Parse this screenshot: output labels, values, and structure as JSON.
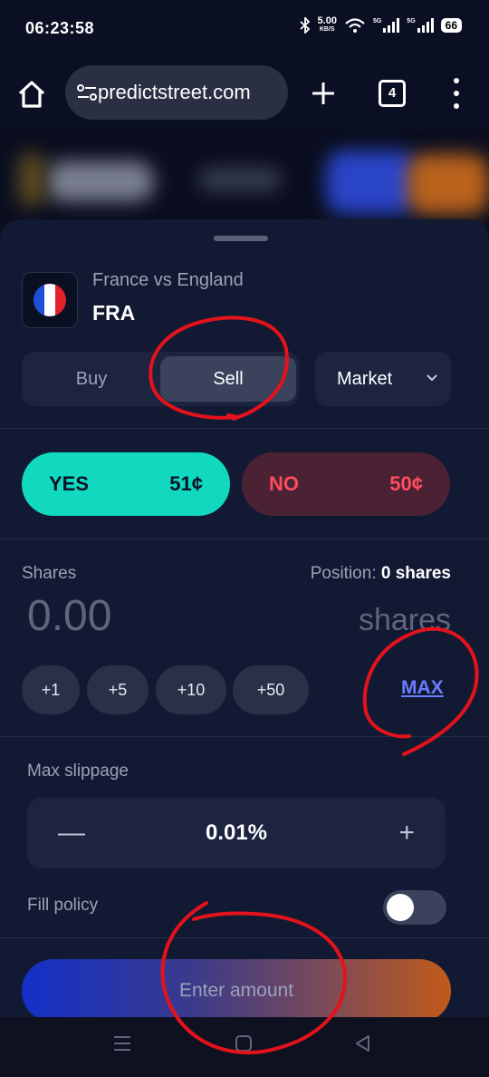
{
  "status_bar": {
    "time": "06:23:58",
    "net_speed": "5.00",
    "net_unit": "KB/S",
    "sig1_label": "5G",
    "sig2_label": "5G",
    "battery": "66"
  },
  "browser": {
    "url": "predictstreet.com",
    "tab_count": "4",
    "icons": [
      "home-icon",
      "site-settings-icon",
      "new-tab-icon",
      "tab-switcher-icon",
      "menu-icon"
    ]
  },
  "market": {
    "match": "France vs England",
    "ticker": "FRA",
    "flag_colors": [
      "#1e4fd8",
      "#ffffff",
      "#e3222b"
    ]
  },
  "order": {
    "side_buy": "Buy",
    "side_sell": "Sell",
    "selected_side": "Sell",
    "order_type": "Market",
    "yes_label": "YES",
    "yes_price": "51¢",
    "no_label": "NO",
    "no_price": "50¢"
  },
  "shares": {
    "label": "Shares",
    "position_label": "Position:",
    "position_value": "0 shares",
    "amount": "0.00",
    "unit": "shares",
    "quick": [
      "+1",
      "+5",
      "+10",
      "+50"
    ],
    "max": "MAX"
  },
  "slippage": {
    "label": "Max slippage",
    "value": "0.01%",
    "minus": "—",
    "plus": "+"
  },
  "fill_policy": {
    "label": "Fill policy",
    "enabled": false
  },
  "cta": {
    "label": "Enter amount"
  },
  "colors": {
    "yes": "#10d9c0",
    "no": "#ff4d5e",
    "link": "#6b7cff",
    "annotation": "#e3121b"
  }
}
